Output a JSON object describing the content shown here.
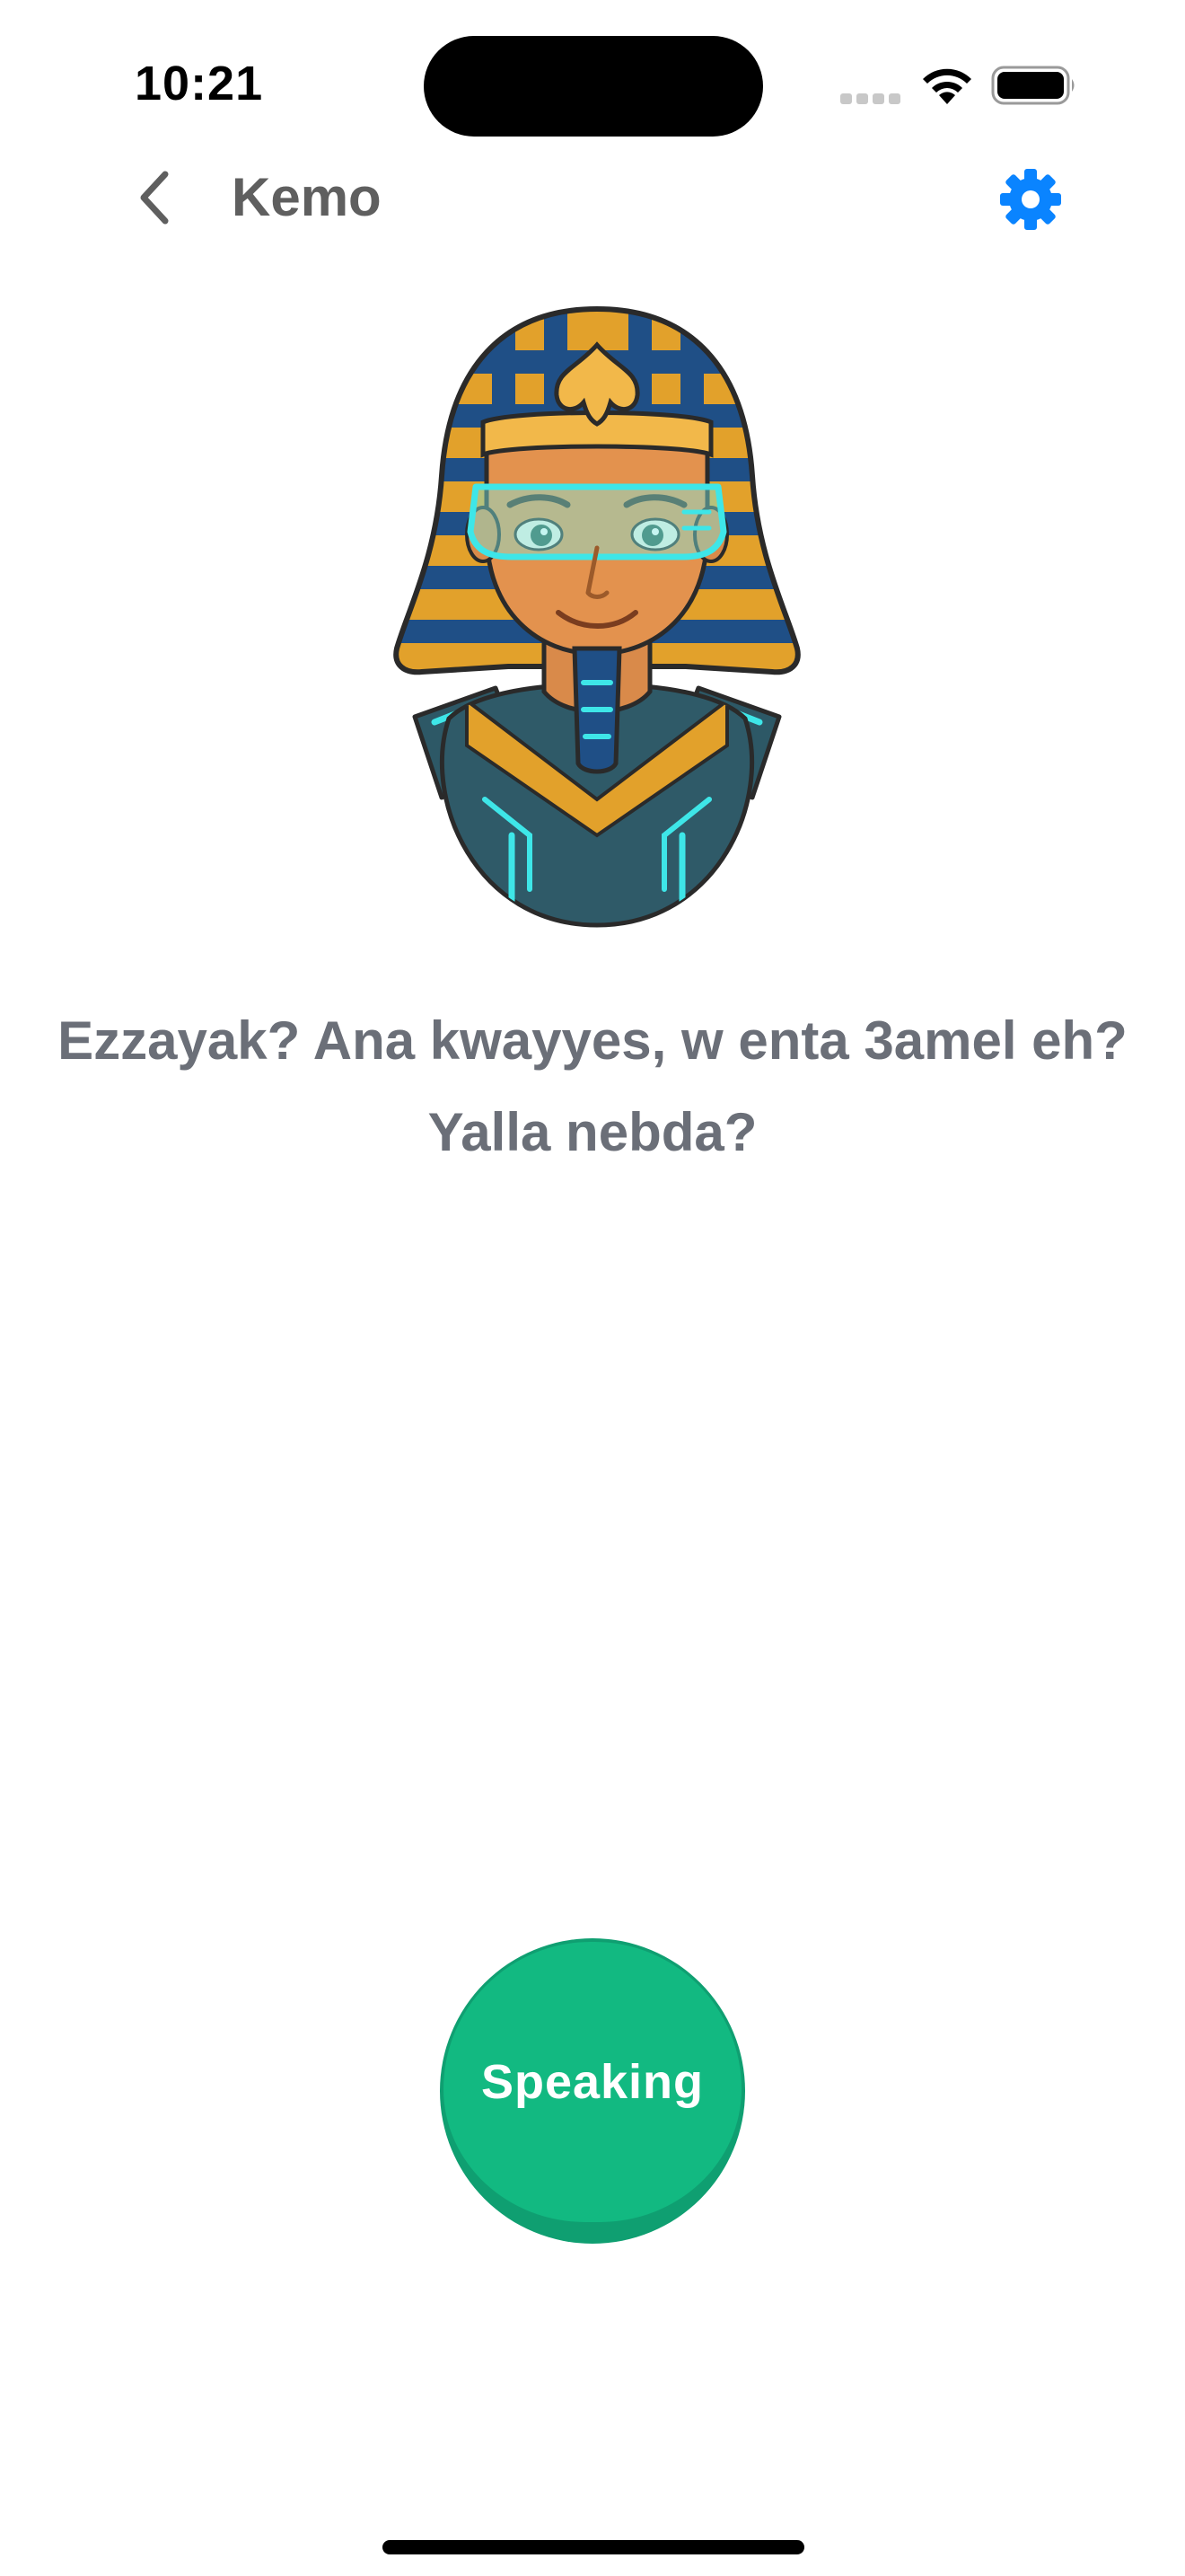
{
  "status_bar": {
    "time": "10:21",
    "icons": [
      "signal-icon",
      "wifi-icon",
      "battery-icon"
    ]
  },
  "nav": {
    "back_icon": "chevron-left-icon",
    "title": "Kemo",
    "settings_icon": "gear-icon",
    "accent_color": "#0a84ff"
  },
  "avatar": {
    "icon": "pharaoh-avatar"
  },
  "message": {
    "text": "Ezzayak? Ana kwayyes, w enta 3amel eh? Yalla nebda?"
  },
  "speaking_button": {
    "label": "Speaking",
    "color": "#12b981"
  }
}
